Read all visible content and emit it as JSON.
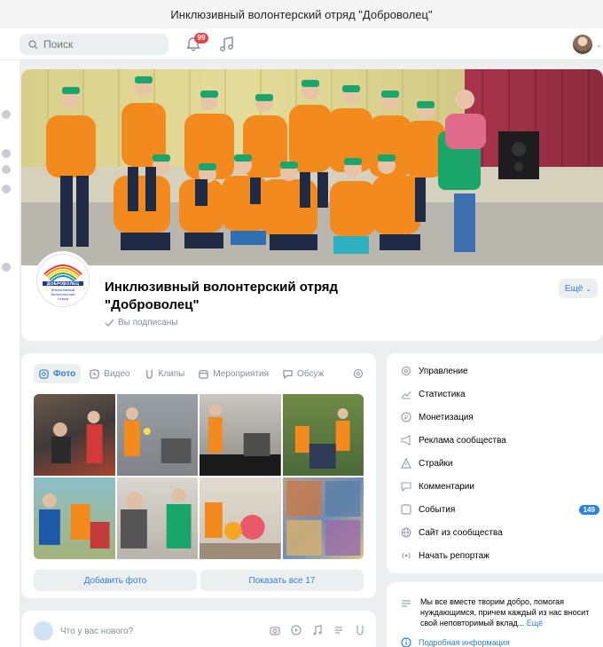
{
  "window": {
    "title": "Инклюзивный волонтерский отряд \"Доброволец\""
  },
  "header": {
    "search_placeholder": "Поиск",
    "notifications_count": "99",
    "icons": [
      "search-icon",
      "bell-icon",
      "music-icon",
      "avatar"
    ]
  },
  "group": {
    "name": "Инклюзивный волонтерский отряд \"Доброволец\"",
    "subscribed_label": "Вы подписаны",
    "more_button": "Ещё",
    "logo_title": "ДОБРОВОЛЕЦ",
    "logo_lines": [
      "Инклюзивный",
      "Волонтерский",
      "Отряд"
    ]
  },
  "tabs": [
    {
      "label": "Фото",
      "icon": "photo-icon",
      "active": true
    },
    {
      "label": "Видео",
      "icon": "video-icon",
      "active": false
    },
    {
      "label": "Клипы",
      "icon": "clips-icon",
      "active": false
    },
    {
      "label": "Мероприятия",
      "icon": "calendar-icon",
      "active": false
    },
    {
      "label": "Обсуж",
      "icon": "discussion-icon",
      "active": false
    }
  ],
  "photos": {
    "add_button": "Добавить фото",
    "show_all_button": "Показать все 17"
  },
  "post": {
    "placeholder": "Что у вас нового?"
  },
  "menu": [
    {
      "label": "Управление",
      "icon": "gear-icon"
    },
    {
      "label": "Статистика",
      "icon": "stats-icon"
    },
    {
      "label": "Монетизация",
      "icon": "coin-icon"
    },
    {
      "label": "Реклама сообщества",
      "icon": "megaphone-icon"
    },
    {
      "label": "Страйки",
      "icon": "warning-icon"
    },
    {
      "label": "Комментарии",
      "icon": "comment-icon"
    },
    {
      "label": "События",
      "icon": "events-icon",
      "count": "149"
    },
    {
      "label": "Сайт из сообщества",
      "icon": "globe-icon"
    },
    {
      "label": "Начать репортаж",
      "icon": "broadcast-icon"
    }
  ],
  "about": {
    "text": "Мы все вместе творим добро, помогая нуждающимся, причем каждый из нас вносит свой неповторимый вклад...",
    "more": "Ещё",
    "details_link": "Подробная информация"
  },
  "colors": {
    "accent": "#2d81e0",
    "badge": "#e64646",
    "hoodie": "#f28a1e",
    "cap": "#1aa56a"
  }
}
